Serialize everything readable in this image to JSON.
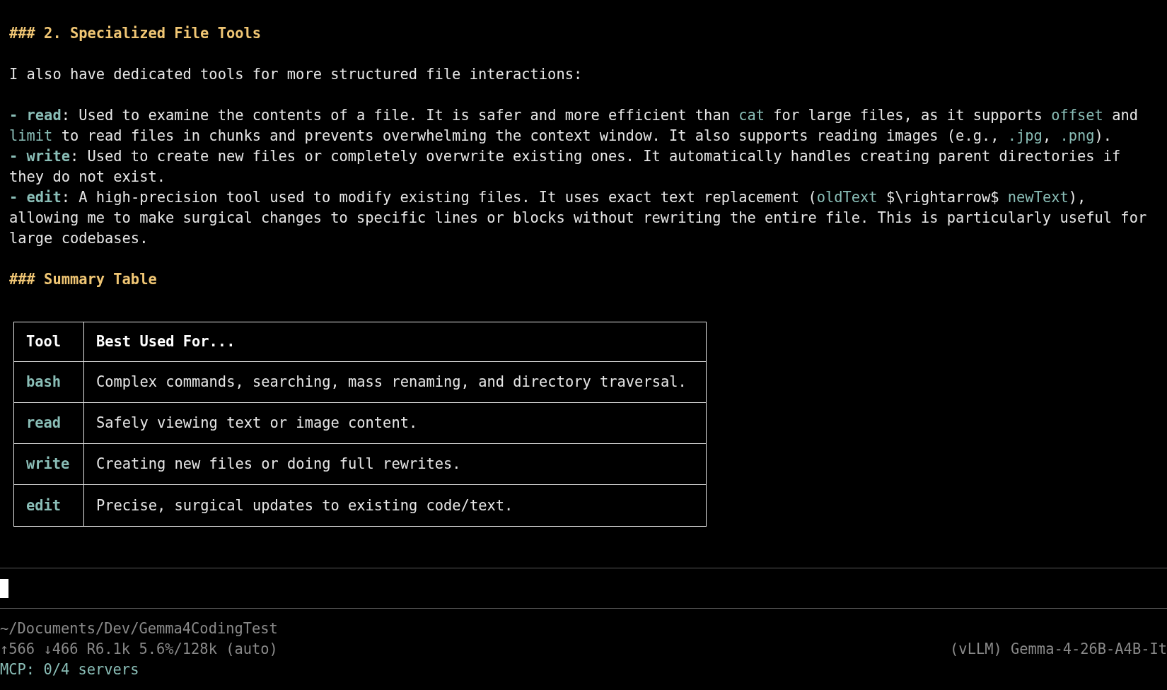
{
  "document": {
    "lines": [
      {
        "kind": "text",
        "segments": [
          {
            "kind": "heading",
            "text": "### 2. Specialized File Tools"
          }
        ]
      },
      {
        "kind": "blank"
      },
      {
        "kind": "text",
        "segments": [
          {
            "kind": "plain",
            "text": "I also have dedicated tools for more structured file interactions:"
          }
        ]
      },
      {
        "kind": "blank"
      },
      {
        "kind": "text",
        "segments": [
          {
            "kind": "tool",
            "text": "- read"
          },
          {
            "kind": "plain",
            "text": ": Used to examine the contents of a file. It is safer and more efficient than "
          },
          {
            "kind": "code",
            "text": "cat"
          },
          {
            "kind": "plain",
            "text": " for large files, as it supports "
          },
          {
            "kind": "code",
            "text": "offset"
          },
          {
            "kind": "plain",
            "text": " and"
          }
        ]
      },
      {
        "kind": "text",
        "segments": [
          {
            "kind": "code",
            "text": "limit"
          },
          {
            "kind": "plain",
            "text": " to read files in chunks and prevents overwhelming the context window. It also supports reading images (e.g., "
          },
          {
            "kind": "code",
            "text": ".jpg"
          },
          {
            "kind": "plain",
            "text": ", "
          },
          {
            "kind": "code",
            "text": ".png"
          },
          {
            "kind": "plain",
            "text": ")."
          }
        ]
      },
      {
        "kind": "text",
        "segments": [
          {
            "kind": "tool",
            "text": "- write"
          },
          {
            "kind": "plain",
            "text": ": Used to create new files or completely overwrite existing ones. It automatically handles creating parent directories if"
          }
        ]
      },
      {
        "kind": "text",
        "segments": [
          {
            "kind": "plain",
            "text": "they do not exist."
          }
        ]
      },
      {
        "kind": "text",
        "segments": [
          {
            "kind": "tool",
            "text": "- edit"
          },
          {
            "kind": "plain",
            "text": ": A high-precision tool used to modify existing files. It uses exact text replacement ("
          },
          {
            "kind": "code",
            "text": "oldText"
          },
          {
            "kind": "plain",
            "text": " $\\rightarrow$ "
          },
          {
            "kind": "code",
            "text": "newText"
          },
          {
            "kind": "plain",
            "text": "),"
          }
        ]
      },
      {
        "kind": "text",
        "segments": [
          {
            "kind": "plain",
            "text": "allowing me to make surgical changes to specific lines or blocks without rewriting the entire file. This is particularly useful for"
          }
        ]
      },
      {
        "kind": "text",
        "segments": [
          {
            "kind": "plain",
            "text": "large codebases."
          }
        ]
      },
      {
        "kind": "blank"
      },
      {
        "kind": "text",
        "segments": [
          {
            "kind": "heading",
            "text": "### Summary Table"
          }
        ]
      }
    ]
  },
  "table": {
    "columns": [
      "Tool",
      "Best Used For..."
    ],
    "rows": [
      {
        "tool": "bash",
        "use": "Complex commands, searching, mass renaming, and directory traversal."
      },
      {
        "tool": "read",
        "use": "Safely viewing text or image content."
      },
      {
        "tool": "write",
        "use": "Creating new files or doing full rewrites."
      },
      {
        "tool": "edit",
        "use": "Precise, surgical updates to existing code/text."
      }
    ]
  },
  "status_bar": {
    "path": "~/Documents/Dev/Gemma4CodingTest",
    "stats": "↑566 ↓466 R6.1k 5.6%/128k (auto)",
    "model": "(vLLM) Gemma-4-26B-A4B-It",
    "mcp": "MCP: 0/4 servers"
  }
}
